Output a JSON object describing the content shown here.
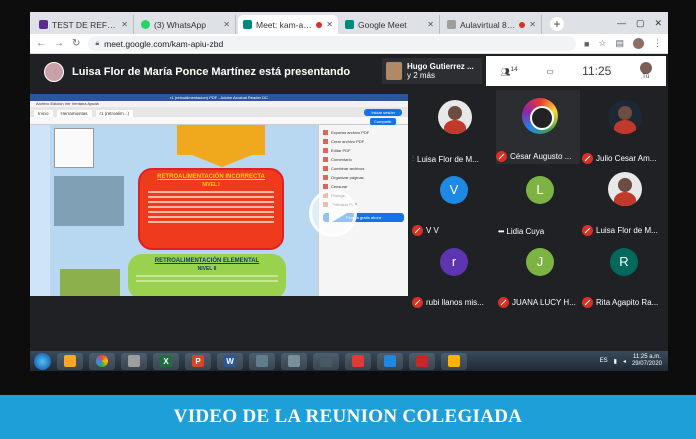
{
  "browser": {
    "tabs": [
      {
        "title": "TEST DE REFORZAMI",
        "favicon_color": "#5c2d91"
      },
      {
        "title": "(3) WhatsApp",
        "favicon_color": "#25d366"
      },
      {
        "title": "Meet: kam-apiu-",
        "favicon_color": "#00897b",
        "recording": true
      },
      {
        "title": "Google Meet",
        "favicon_color": "#00897b"
      },
      {
        "title": "Aulavirtual 855 |",
        "favicon_color": "#9e9e9e",
        "recording": true
      }
    ],
    "new_tab": "+",
    "url": "meet.google.com/kam-apiu-zbd"
  },
  "meet": {
    "presenting_text": "Luisa Flor de María Ponce Martínez está presentando",
    "presenter_chip": {
      "name": "Hugo Gutierrez ...",
      "more": "y 2 más"
    },
    "participant_count": "14",
    "clock": "11:25",
    "you_label": "Tú",
    "participants": [
      {
        "name": "Luisa Flor de M...",
        "avatar": "photo",
        "status": "speaking"
      },
      {
        "name": "César Augusto ...",
        "avatar": "logo",
        "status": "muted"
      },
      {
        "name": "Julio Cesar Am...",
        "avatar": "photo",
        "status": "muted"
      },
      {
        "name": "V V",
        "avatar": "letter",
        "letter": "V",
        "color": "#1e88e5",
        "status": "muted"
      },
      {
        "name": "Lidia Cuya",
        "avatar": "letter",
        "letter": "L",
        "color": "#7cb342",
        "status": "active"
      },
      {
        "name": "Luisa Flor de M...",
        "avatar": "photo",
        "status": "muted"
      },
      {
        "name": "rubi llanos mis...",
        "avatar": "letter",
        "letter": "r",
        "color": "#5e35b1",
        "status": "muted"
      },
      {
        "name": "JUANA LUCY H...",
        "avatar": "letter",
        "letter": "J",
        "color": "#7cb342",
        "status": "muted"
      },
      {
        "name": "Rita Agapito Ra...",
        "avatar": "letter",
        "letter": "R",
        "color": "#00695c",
        "status": "muted"
      }
    ]
  },
  "shared_screen": {
    "app_title": "r1 (retroalimentacion) PDF - Adobe Acrobat Reader DC",
    "menu": "Archivo  Edición  Ver  Ventana  Ayuda",
    "doc_tabs": [
      "Inicio",
      "Herramientas",
      "r1 (retroalim...)"
    ],
    "share_button": "Compartir",
    "top_right_button": "Iniciar sesión",
    "red_box_title": "RETROALIMENTACIÓN INCORRECTA",
    "red_box_level": "NIVEL I",
    "green_box_title": "RETROALIMENTACIÓN ELEMENTAL",
    "green_box_level": "NIVEL II",
    "side_items": [
      "Exportar archivo PDF",
      "Crear archivo PDF",
      "Editar PDF",
      "Comentario",
      "Combinar archivos",
      "Organizar páginas",
      "Censurar",
      "Proteger",
      "Optimizar PDF"
    ],
    "side_button": "Prueba gratis ahora"
  },
  "taskbar": {
    "apps": [
      {
        "label": "",
        "color": "#f9a825"
      },
      {
        "label": "",
        "color": "#4285f4"
      },
      {
        "label": "",
        "color": "#9e9e9e"
      },
      {
        "label": "X",
        "color": "#1d6f42"
      },
      {
        "label": "P",
        "color": "#d24726"
      },
      {
        "label": "W",
        "color": "#2b579a"
      },
      {
        "label": "",
        "color": "#607d8b"
      },
      {
        "label": "",
        "color": "#78909c"
      },
      {
        "label": "",
        "color": "#455a64"
      },
      {
        "label": "",
        "color": "#e53935"
      },
      {
        "label": "",
        "color": "#1e88e5"
      },
      {
        "label": "",
        "color": "#c62828"
      },
      {
        "label": "",
        "color": "#ffb300"
      }
    ],
    "lang": "ES",
    "time": "11:25 a.m.",
    "date": "29/07/2020"
  },
  "banner": "VIDEO DE LA REUNION COLEGIADA"
}
